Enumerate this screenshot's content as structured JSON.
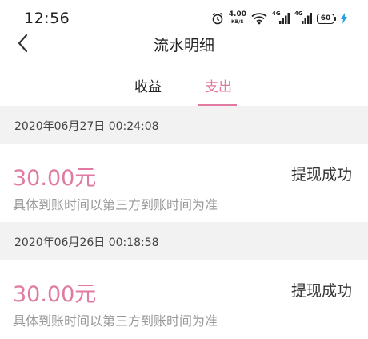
{
  "status_bar": {
    "time": "12:56",
    "speed_value": "4.00",
    "speed_unit": "KB/S",
    "signal1_label": "4G",
    "signal2_label": "4G",
    "battery": "60"
  },
  "nav": {
    "title": "流水明细",
    "back_icon": "chevron-left-icon"
  },
  "tabs": [
    {
      "label": "收益",
      "active": false
    },
    {
      "label": "支出",
      "active": true
    }
  ],
  "records": [
    {
      "date": "2020年06月27日 00:24:08",
      "amount": "30.00元",
      "status": "提现成功",
      "note": "具体到账时间以第三方到账时间为准"
    },
    {
      "date": "2020年06月26日 00:18:58",
      "amount": "30.00元",
      "status": "提现成功",
      "note": "具体到账时间以第三方到账时间为准"
    }
  ],
  "colors": {
    "accent": "#e07aa0",
    "date_row_bg": "#f2f2f2",
    "note_text": "#999999"
  }
}
